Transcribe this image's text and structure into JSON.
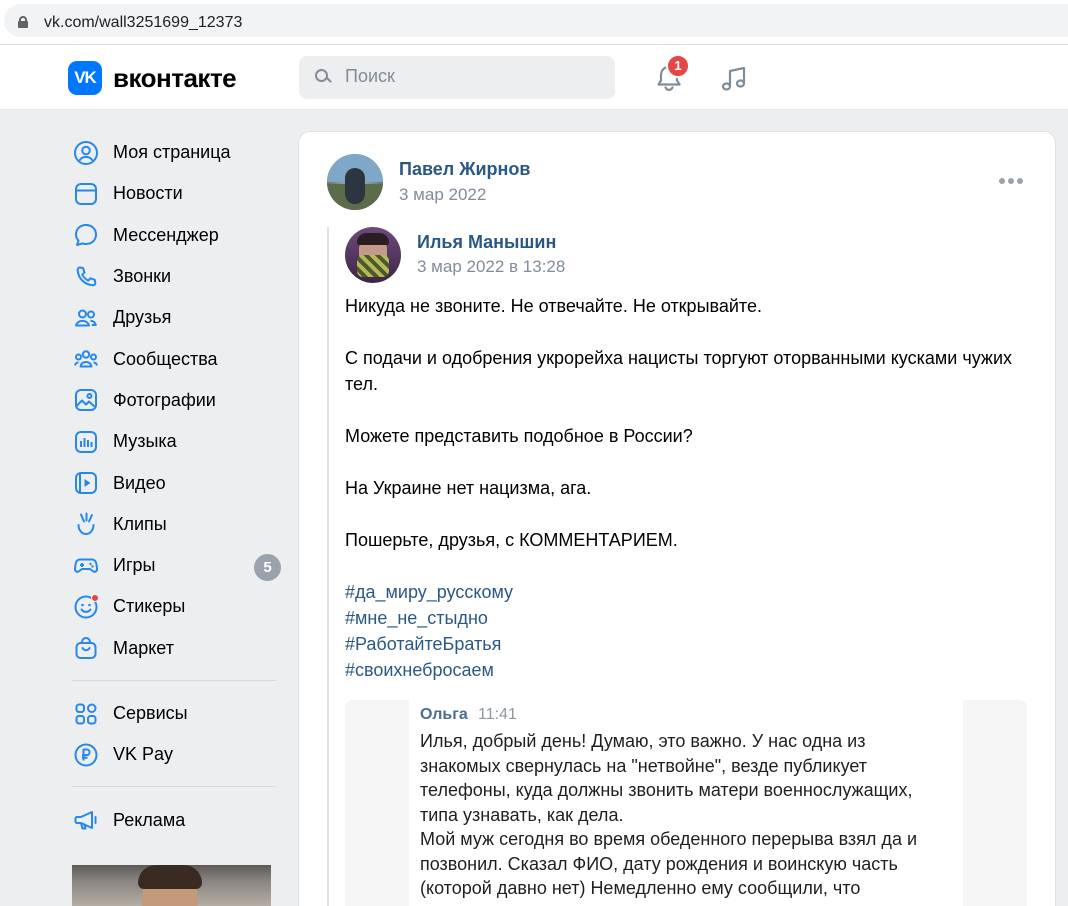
{
  "browser": {
    "url": "vk.com/wall3251699_12373"
  },
  "header": {
    "logo_mark": "VK",
    "logo_text": "вконтакте",
    "search_placeholder": "Поиск",
    "notifications_count": "1"
  },
  "sidebar": {
    "items": [
      {
        "label": "Моя страница",
        "icon": "user-circle-icon"
      },
      {
        "label": "Новости",
        "icon": "news-icon"
      },
      {
        "label": "Мессенджер",
        "icon": "message-icon"
      },
      {
        "label": "Звонки",
        "icon": "phone-icon"
      },
      {
        "label": "Друзья",
        "icon": "friends-icon"
      },
      {
        "label": "Сообщества",
        "icon": "communities-icon"
      },
      {
        "label": "Фотографии",
        "icon": "photo-icon"
      },
      {
        "label": "Музыка",
        "icon": "music-icon"
      },
      {
        "label": "Видео",
        "icon": "video-icon"
      },
      {
        "label": "Клипы",
        "icon": "clips-icon"
      },
      {
        "label": "Игры",
        "icon": "games-icon",
        "count": "5"
      },
      {
        "label": "Стикеры",
        "icon": "sticker-icon"
      },
      {
        "label": "Маркет",
        "icon": "market-icon"
      }
    ],
    "secondary": [
      {
        "label": "Сервисы",
        "icon": "services-icon"
      },
      {
        "label": "VK Pay",
        "icon": "vkpay-icon"
      }
    ],
    "tertiary": [
      {
        "label": "Реклама",
        "icon": "ads-icon"
      }
    ]
  },
  "post": {
    "author": "Павел Жирнов",
    "date": "3 мар 2022",
    "repost": {
      "author": "Илья Манышин",
      "date": "3 мар 2022 в 13:28",
      "paragraphs": [
        "Никуда не звоните. Не отвечайте. Не открывайте.",
        "С подачи и одобрения укрорейха нацисты торгуют оторванными кусками чужих тел.",
        "Можете представить подобное в России?",
        "На Украине нет нацизма, ага.",
        "Пошерьте, друзья, с КОММЕНТАРИЕМ."
      ],
      "hashtags": [
        "#да_миру_русскому",
        "#мне_не_стыдно",
        "#РаботайтеБратья",
        "#своихнебросаем"
      ],
      "screenshot": {
        "sender": "Ольга",
        "time": "11:41",
        "lines": [
          "Илья, добрый день! Думаю, это важно. У нас одна из",
          "знакомых свернулась на \"нетвойне\", везде публикует",
          "телефоны, куда должны звонить матери военнослужащих,",
          "типа узнавать, как дела.",
          "Мой муж сегодня во время обеденного перерыва взял да и",
          "позвонил. Сказал ФИО, дату рождения и воинскую часть",
          "(которой давно нет) Немедленно ему сообщили, что"
        ]
      }
    }
  },
  "colors": {
    "accent": "#0077ff",
    "link": "#2a5885",
    "badge": "#e64646",
    "page_bg": "#edeef0"
  }
}
